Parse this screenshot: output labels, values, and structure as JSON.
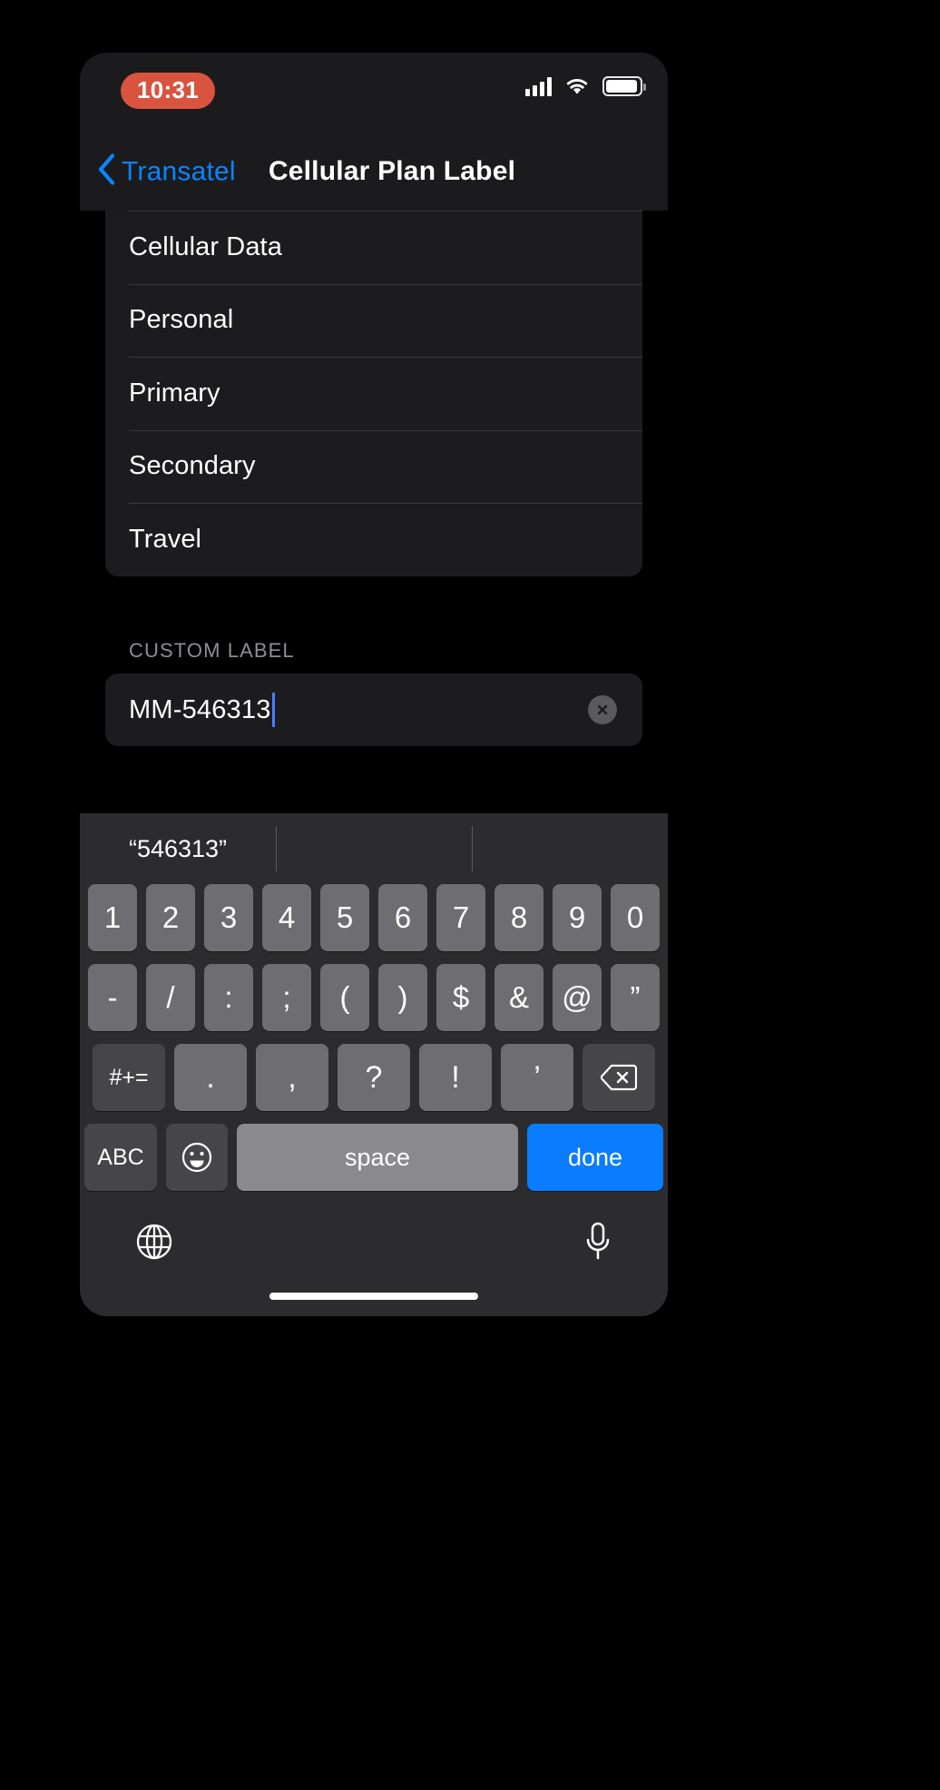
{
  "status_bar": {
    "time": "10:31",
    "icons": [
      "cellular-signal-icon",
      "wifi-icon",
      "battery-icon"
    ]
  },
  "nav_bar": {
    "back_label": "Transatel",
    "back_icon": "chevron-left-icon",
    "title": "Cellular Plan Label"
  },
  "options": [
    {
      "label": "Cellular Data"
    },
    {
      "label": "Personal"
    },
    {
      "label": "Primary"
    },
    {
      "label": "Secondary"
    },
    {
      "label": "Travel"
    }
  ],
  "custom_label": {
    "header": "CUSTOM LABEL",
    "value": "MM-546313",
    "clear_icon": "clear-circle-x-icon"
  },
  "keyboard": {
    "suggestions": [
      "“546313”",
      "",
      ""
    ],
    "rows": {
      "numbers": [
        "1",
        "2",
        "3",
        "4",
        "5",
        "6",
        "7",
        "8",
        "9",
        "0"
      ],
      "symbols": [
        "-",
        "/",
        ":",
        ";",
        "(",
        ")",
        "$",
        "&",
        "@",
        "”"
      ],
      "symbols2": {
        "shift": "#+=",
        "keys": [
          ".",
          ",",
          "?",
          "!",
          "’"
        ],
        "backspace_icon": "backspace-icon"
      },
      "bottom": {
        "abc": "ABC",
        "emoji_icon": "emoji-smiley-icon",
        "space": "space",
        "done": "done"
      }
    },
    "footer": {
      "globe_icon": "globe-icon",
      "mic_icon": "microphone-icon"
    }
  },
  "colors": {
    "accent_blue": "#0a84ff",
    "key_blue": "#0a7cff",
    "time_pill_red": "#d9543f",
    "card_bg": "#1c1c1e",
    "keyboard_bg": "#2c2c2e"
  }
}
